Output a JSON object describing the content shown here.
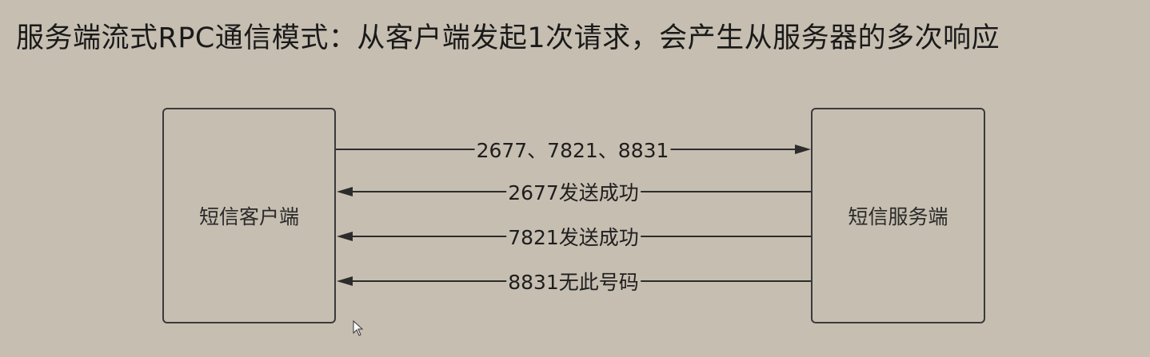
{
  "title": "服务端流式RPC通信模式：从客户端发起1次请求，会产生从服务器的多次响应",
  "diagram": {
    "client_label": "短信客户端",
    "server_label": "短信服务端",
    "request_message": "2677、7821、8831",
    "responses": [
      "2677发送成功",
      "7821发送成功",
      "8831无此号码"
    ]
  },
  "colors": {
    "background": "#c6beb1",
    "stroke": "#3a3a3a"
  },
  "icons": [
    "arrow-pointer-icon"
  ]
}
